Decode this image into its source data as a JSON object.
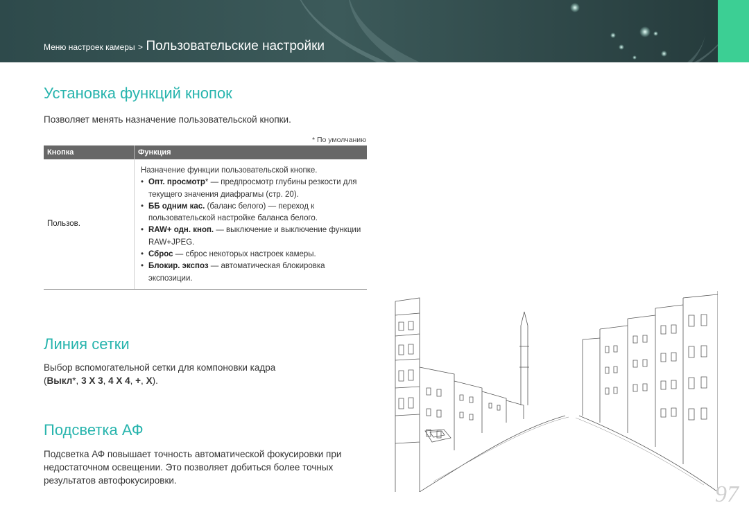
{
  "header": {
    "breadcrumb_parent": "Меню настроек камеры",
    "breadcrumb_separator": ">",
    "breadcrumb_current": "Пользовательские настройки"
  },
  "section1": {
    "title": "Установка функций кнопок",
    "description": "Позволяет менять назначение пользовательской кнопки.",
    "default_note": "* По умолчанию",
    "table": {
      "col1_header": "Кнопка",
      "col2_header": "Функция",
      "row_button": "Пользов.",
      "intro": "Назначение функции пользовательской кнопке.",
      "items": [
        {
          "term": "Опт. просмотр",
          "mark": "*",
          "text": " — предпросмотр глубины резкости для текущего значения диафрагмы (стр. 20)."
        },
        {
          "term": "ББ одним кас.",
          "mark": "",
          "text": " (баланс белого) — переход к пользовательской настройке баланса белого."
        },
        {
          "term": "RAW+ одн. кноп.",
          "mark": "",
          "text": " — выключение и выключение функции RAW+JPEG."
        },
        {
          "term": "Сброс",
          "mark": "",
          "text": " — сброс некоторых настроек камеры."
        },
        {
          "term": "Блокир. экспоз",
          "mark": "",
          "text": " — автоматическая блокировка экспозиции."
        }
      ]
    }
  },
  "section2": {
    "title": "Линия сетки",
    "description": "Выбор вспомогательной сетки для компоновки кадра",
    "options": [
      {
        "label": "Выкл",
        "mark": "*"
      },
      {
        "label": "3 X 3",
        "mark": ""
      },
      {
        "label": "4 X 4",
        "mark": ""
      },
      {
        "label": "+",
        "mark": ""
      },
      {
        "label": "X",
        "mark": ""
      }
    ]
  },
  "section3": {
    "title": "Подсветка АФ",
    "description": "Подсветка АФ повышает точность автоматической фокусировки при недостаточном освещении. Это позволяет добиться более точных результатов автофокусировки."
  },
  "page_number": "97",
  "colors": {
    "header_bg": "#334f50",
    "accent_green": "#3ccf94",
    "title_teal": "#27b4ad"
  }
}
